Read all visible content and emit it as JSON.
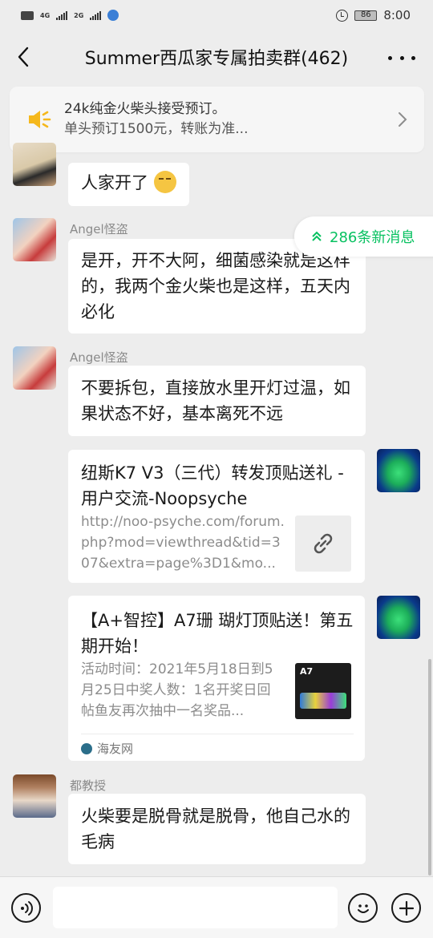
{
  "status_bar": {
    "network_1": "4G",
    "network_2": "2G",
    "battery": "86",
    "time": "8:00"
  },
  "header": {
    "title": "Summer西瓜家专属拍卖群(462)"
  },
  "announcement": {
    "line1": "24k纯金火柴头接受预订。",
    "line2": "单头预订1500元，转账为准..."
  },
  "new_messages": {
    "label": "286条新消息"
  },
  "messages": [
    {
      "text": "人家开了"
    },
    {
      "sender": "Angel怪盗",
      "text": "是开，开不大阿，细菌感染就是这样的，我两个金火柴也是这样，五天内必化"
    },
    {
      "sender": "Angel怪盗",
      "text": "不要拆包，直接放水里开灯过温，如果状态不好，基本离死不远"
    },
    {
      "type": "link_card",
      "title": "纽斯K7 V3（三代）转发顶贴送礼 - 用户交流-Noopsyche",
      "description": "http://noo-psyche.com/forum.php?mod=viewthread&tid=307&extra=page%3D1&mo..."
    },
    {
      "type": "article_card",
      "title": "【A+智控】A7珊 瑚灯顶贴送！第五期开始！",
      "description": "活动时间：2021年5月18日到5月25日中奖人数：1名开奖日回帖鱼友再次抽中一名奖品...",
      "thumb_label": "A7",
      "source": "海友网"
    },
    {
      "sender": "都教授",
      "text": "火柴要是脱骨就是脱骨，他自己水的毛病"
    }
  ],
  "input": {
    "placeholder": ""
  },
  "colors": {
    "accent_green": "#07c160",
    "announce_icon": "#f5b81c",
    "background": "#ededed"
  }
}
